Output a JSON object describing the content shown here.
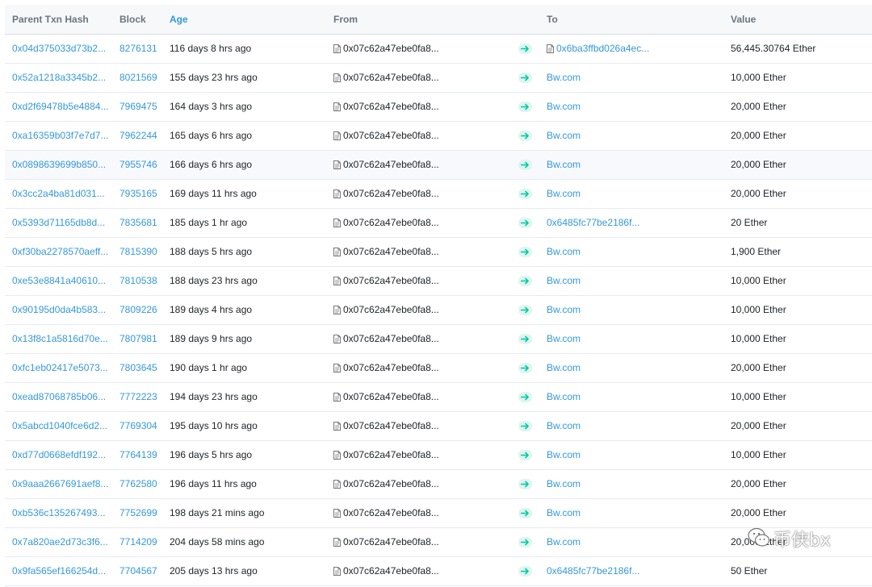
{
  "table": {
    "columns": {
      "parent_txn_hash": "Parent Txn Hash",
      "block": "Block",
      "age": "Age",
      "from": "From",
      "to": "To",
      "value": "Value"
    },
    "rows": [
      {
        "hash": "0x04d375033d73b2...",
        "block": "8276131",
        "age": "116 days 8 hrs ago",
        "from": "0x07c62a47ebe0fa8...",
        "to": "0x6ba3ffbd026a4ec...",
        "to_is_contract": true,
        "value": "56,445.30764 Ether"
      },
      {
        "hash": "0x52a1218a3345b2...",
        "block": "8021569",
        "age": "155 days 23 hrs ago",
        "from": "0x07c62a47ebe0fa8...",
        "to": "Bw.com",
        "to_is_contract": false,
        "value": "10,000 Ether"
      },
      {
        "hash": "0xd2f69478b5e4884...",
        "block": "7969475",
        "age": "164 days 3 hrs ago",
        "from": "0x07c62a47ebe0fa8...",
        "to": "Bw.com",
        "to_is_contract": false,
        "value": "20,000 Ether"
      },
      {
        "hash": "0xa16359b03f7e7d7...",
        "block": "7962244",
        "age": "165 days 6 hrs ago",
        "from": "0x07c62a47ebe0fa8...",
        "to": "Bw.com",
        "to_is_contract": false,
        "value": "20,000 Ether"
      },
      {
        "hash": "0x0898639699b850...",
        "block": "7955746",
        "age": "166 days 6 hrs ago",
        "from": "0x07c62a47ebe0fa8...",
        "to": "Bw.com",
        "to_is_contract": false,
        "value": "20,000 Ether"
      },
      {
        "hash": "0x3cc2a4ba81d031...",
        "block": "7935165",
        "age": "169 days 11 hrs ago",
        "from": "0x07c62a47ebe0fa8...",
        "to": "Bw.com",
        "to_is_contract": false,
        "value": "20,000 Ether"
      },
      {
        "hash": "0x5393d71165db8d...",
        "block": "7835681",
        "age": "185 days 1 hr ago",
        "from": "0x07c62a47ebe0fa8...",
        "to": "0x6485fc77be2186f...",
        "to_is_contract": false,
        "value": "20 Ether"
      },
      {
        "hash": "0xf30ba2278570aeff...",
        "block": "7815390",
        "age": "188 days 5 hrs ago",
        "from": "0x07c62a47ebe0fa8...",
        "to": "Bw.com",
        "to_is_contract": false,
        "value": "1,900 Ether"
      },
      {
        "hash": "0xe53e8841a40610...",
        "block": "7810538",
        "age": "188 days 23 hrs ago",
        "from": "0x07c62a47ebe0fa8...",
        "to": "Bw.com",
        "to_is_contract": false,
        "value": "10,000 Ether"
      },
      {
        "hash": "0x90195d0da4b583...",
        "block": "7809226",
        "age": "189 days 4 hrs ago",
        "from": "0x07c62a47ebe0fa8...",
        "to": "Bw.com",
        "to_is_contract": false,
        "value": "10,000 Ether"
      },
      {
        "hash": "0x13f8c1a5816d70e...",
        "block": "7807981",
        "age": "189 days 9 hrs ago",
        "from": "0x07c62a47ebe0fa8...",
        "to": "Bw.com",
        "to_is_contract": false,
        "value": "10,000 Ether"
      },
      {
        "hash": "0xfc1eb02417e5073...",
        "block": "7803645",
        "age": "190 days 1 hr ago",
        "from": "0x07c62a47ebe0fa8...",
        "to": "Bw.com",
        "to_is_contract": false,
        "value": "20,000 Ether"
      },
      {
        "hash": "0xead87068785b06...",
        "block": "7772223",
        "age": "194 days 23 hrs ago",
        "from": "0x07c62a47ebe0fa8...",
        "to": "Bw.com",
        "to_is_contract": false,
        "value": "10,000 Ether"
      },
      {
        "hash": "0x5abcd1040fce6d2...",
        "block": "7769304",
        "age": "195 days 10 hrs ago",
        "from": "0x07c62a47ebe0fa8...",
        "to": "Bw.com",
        "to_is_contract": false,
        "value": "20,000 Ether"
      },
      {
        "hash": "0xd77d0668efdf192...",
        "block": "7764139",
        "age": "196 days 5 hrs ago",
        "from": "0x07c62a47ebe0fa8...",
        "to": "Bw.com",
        "to_is_contract": false,
        "value": "10,000 Ether"
      },
      {
        "hash": "0x9aaa2667691aef8...",
        "block": "7762580",
        "age": "196 days 11 hrs ago",
        "from": "0x07c62a47ebe0fa8...",
        "to": "Bw.com",
        "to_is_contract": false,
        "value": "20,000 Ether"
      },
      {
        "hash": "0xb536c135267493...",
        "block": "7752699",
        "age": "198 days 21 mins ago",
        "from": "0x07c62a47ebe0fa8...",
        "to": "Bw.com",
        "to_is_contract": false,
        "value": "20,000 Ether"
      },
      {
        "hash": "0x7a820ae2d73c3f6...",
        "block": "7714209",
        "age": "204 days 58 mins ago",
        "from": "0x07c62a47ebe0fa8...",
        "to": "Bw.com",
        "to_is_contract": false,
        "value": "20,000 Ether"
      },
      {
        "hash": "0x9fa565ef166254d...",
        "block": "7704567",
        "age": "205 days 13 hrs ago",
        "from": "0x07c62a47ebe0fa8...",
        "to": "0x6485fc77be2186f...",
        "to_is_contract": false,
        "value": "50 Ether"
      }
    ]
  },
  "highlighted_row_index": 4,
  "icons": {
    "contract": "file-document-icon",
    "direction": "arrow-right-icon",
    "watermark": "wechat-logo"
  },
  "colors": {
    "link": "#3498db",
    "arrow": "#00c9a7",
    "arrow_bg": "#dff5ef",
    "header_bg": "#f7f8fa"
  },
  "watermark": {
    "text": "币侠bx"
  }
}
